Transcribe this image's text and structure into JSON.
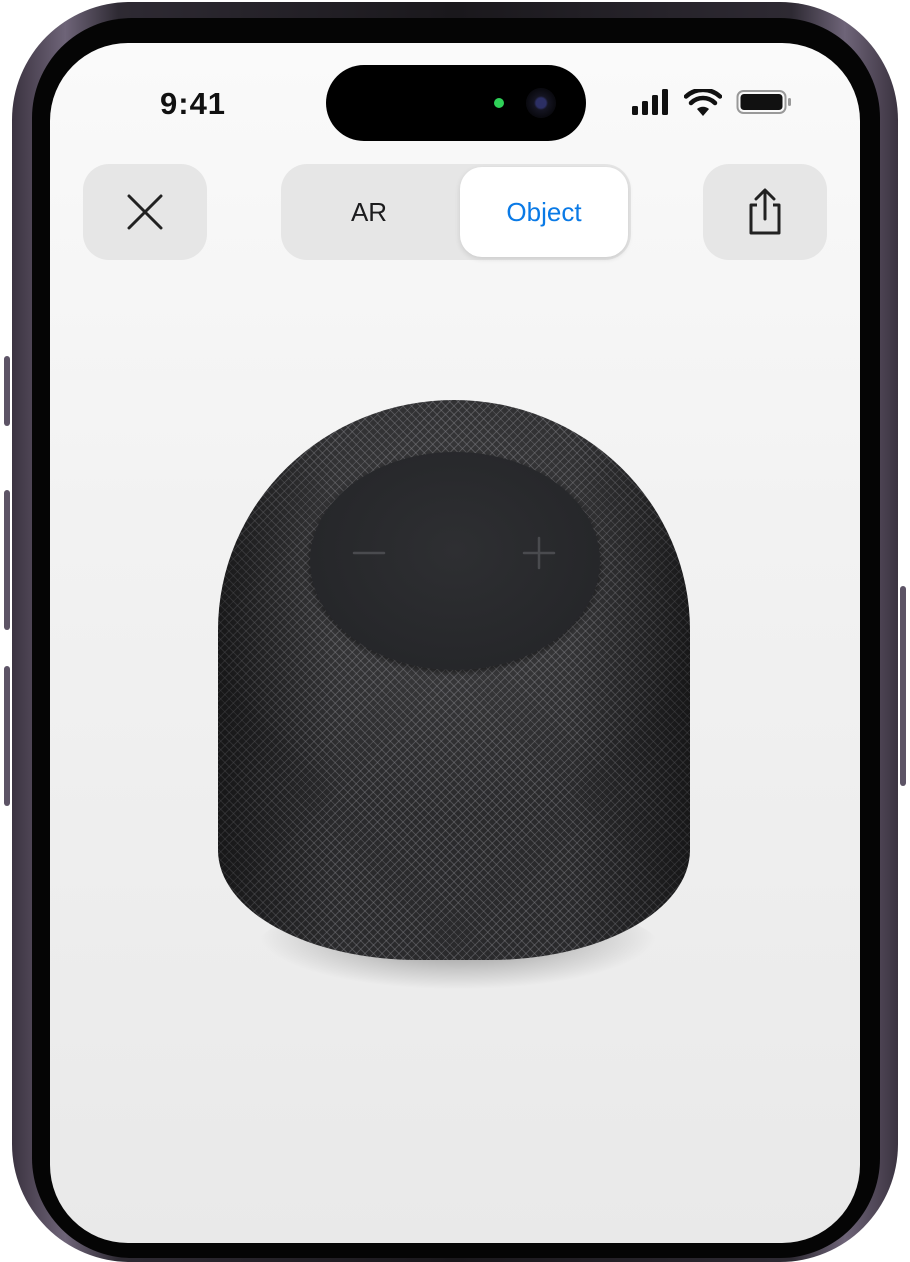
{
  "status_bar": {
    "time": "9:41",
    "icons": [
      "signal-icon",
      "wifi-icon",
      "battery-icon"
    ]
  },
  "toolbar": {
    "close_icon": "close-icon",
    "share_icon": "share-icon",
    "segments": [
      {
        "label": "AR",
        "selected": false
      },
      {
        "label": "Object",
        "selected": true
      }
    ]
  },
  "product": {
    "controls": [
      "minus-icon",
      "plus-icon"
    ]
  },
  "colors": {
    "accent": "#0a7ae6",
    "camera_indicator": "#2fd158",
    "speaker": "#2a2a2c"
  }
}
